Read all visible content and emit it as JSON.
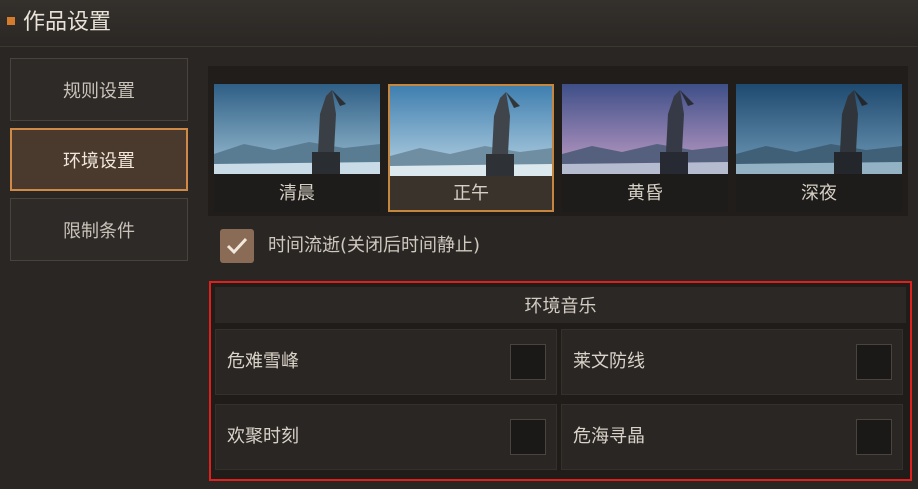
{
  "window": {
    "title": "作品设置"
  },
  "nav": {
    "items": [
      {
        "label": "规则设置"
      },
      {
        "label": "环境设置"
      },
      {
        "label": "限制条件"
      }
    ]
  },
  "time_of_day": {
    "options": [
      {
        "label": "清晨"
      },
      {
        "label": "正午"
      },
      {
        "label": "黄昏"
      },
      {
        "label": "深夜"
      }
    ],
    "selected": "正午"
  },
  "time_flow": {
    "label": "时间流逝(关闭后时间静止)",
    "checked": true
  },
  "music": {
    "header": "环境音乐",
    "tracks": [
      {
        "label": "危难雪峰"
      },
      {
        "label": "莱文防线"
      },
      {
        "label": "欢聚时刻"
      },
      {
        "label": "危海寻晶"
      }
    ]
  },
  "colors": {
    "accent": "#d08a48",
    "highlight": "#e0201c"
  }
}
